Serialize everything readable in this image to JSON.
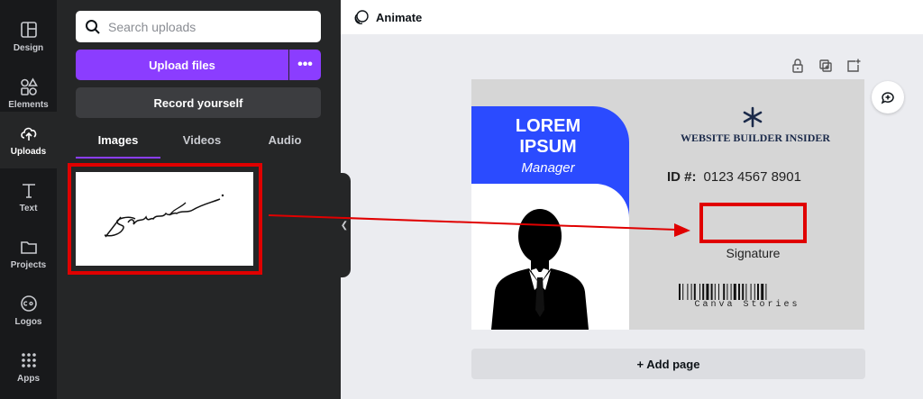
{
  "rail": {
    "items": [
      {
        "label": "Design",
        "icon": "layout-icon"
      },
      {
        "label": "Elements",
        "icon": "shapes-icon"
      },
      {
        "label": "Uploads",
        "icon": "cloud-upload-icon",
        "active": true
      },
      {
        "label": "Text",
        "icon": "text-icon"
      },
      {
        "label": "Projects",
        "icon": "folder-icon"
      },
      {
        "label": "Logos",
        "icon": "logo-badge-icon"
      },
      {
        "label": "Apps",
        "icon": "grid-dots-icon"
      }
    ]
  },
  "uploads": {
    "search_placeholder": "Search uploads",
    "upload_label": "Upload files",
    "more_label": "•••",
    "record_label": "Record yourself",
    "tabs": [
      "Images",
      "Videos",
      "Audio"
    ],
    "active_tab": "Images"
  },
  "topbar": {
    "animate_label": "Animate"
  },
  "card": {
    "name_line1": "LOREM",
    "name_line2": "IPSUM",
    "role": "Manager",
    "brand": "WEBSITE BUILDER INSIDER",
    "id_label": "ID #:",
    "id_value": "0123 4567 8901",
    "signature_label": "Signature",
    "barcode_text": "Canva Stories"
  },
  "add_page_label": "+ Add page",
  "colors": {
    "accent": "#8b3dff",
    "card_blue": "#2b4bff",
    "highlight_red": "#e00000",
    "panel_bg": "#252627",
    "rail_bg": "#18191b"
  }
}
